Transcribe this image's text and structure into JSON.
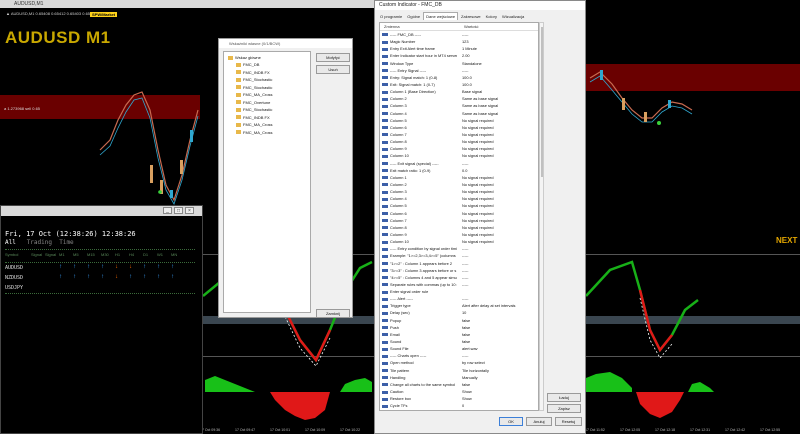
{
  "chart": {
    "window_title": "AUDUSD,M1",
    "info_line": "▲ AUDUSD,M1  0.65408 0.65412 0.65403 0.65411",
    "badge": "SPW/Market",
    "symbol_title": "AUDUSD M1",
    "price_label": "a 1.273968 sell 0.65",
    "next_label": "NEXT",
    "time_ticks": [
      "17 Oct 09:36",
      "17 Oct 09:47",
      "17 Oct 10:01",
      "17 Oct 10:09",
      "17 Oct 10:22",
      "17 Oct 10:35",
      "17 Oct 10:47",
      "17 Oct 11:00",
      "17 Oct 11:13",
      "17 Oct 11:26",
      "17 Oct 11:39",
      "17 Oct 11:52",
      "17 Oct 12:05",
      "17 Oct 12:18",
      "17 Oct 12:31",
      "17 Oct 12:42",
      "17 Oct 12:55"
    ]
  },
  "scanner": {
    "date_line": "Fri, 17 Oct (12:38:26) 12:38:26",
    "tabs": [
      "All",
      "Trading",
      "Time"
    ],
    "header": [
      "Symbol",
      "Signal",
      "Signal",
      "M1",
      "M5",
      "M15",
      "M30",
      "H1",
      "H4",
      "D1",
      "W1",
      "MN"
    ],
    "rows": [
      {
        "symbol": "AUDUSD",
        "arrows": [
          "up",
          "up",
          "up",
          "up",
          "dn",
          "dn",
          "up",
          "up",
          "up"
        ]
      },
      {
        "symbol": "NZDUSD",
        "arrows": [
          "up",
          "up",
          "up",
          "up",
          "dn",
          "up",
          "up",
          "up",
          "up"
        ]
      },
      {
        "symbol": "USDJPY",
        "arrows": [
          "",
          "",
          "",
          "",
          "",
          "",
          "",
          "",
          ""
        ]
      }
    ],
    "win_buttons": [
      "_",
      "□",
      "×"
    ]
  },
  "navigator": {
    "title": "Wskaźniki własne (0/1/BCW)",
    "root": "Wskaz główne",
    "items": [
      "FMC_DB",
      "FMC_INDB FX",
      "FMC_Stochastic",
      "FMC_Stochastic",
      "FMC_MA_Cross",
      "FMC_Overtune",
      "FMC_Stochastic",
      "FMC_INDB FX",
      "FMC_MA_Cross",
      "FMC_MA_Cross"
    ],
    "buttons": {
      "modify": "Mofyfyć",
      "delete": "Usuń",
      "close": "Zamknij"
    }
  },
  "dialog": {
    "title": "Custom Indicator - FMC_DB",
    "tabs": [
      "O programie",
      "Ogólne",
      "Dane wejściowe",
      "Zakresowe",
      "Kolory",
      "Wizualizacja"
    ],
    "active_tab": 2,
    "col_name": "Zmienna",
    "col_value": "Wartość",
    "params": [
      {
        "n": "----- FMC_DB -----",
        "v": "-----"
      },
      {
        "n": "Magic Number",
        "v": "123"
      },
      {
        "n": "Entry Exit Alert time frame",
        "v": "1 Minute"
      },
      {
        "n": "Enter Indicator start hour in MT4 server time",
        "v": "2.00"
      },
      {
        "n": "Window Type",
        "v": "Standalone"
      },
      {
        "n": "----- Entry Signal -----",
        "v": "-----"
      },
      {
        "n": "Entry: Signal match: 1 (0-8)",
        "v": "100.0"
      },
      {
        "n": "Exit: Signal match: 1 (0-7)",
        "v": "100.0"
      },
      {
        "n": "Column 1 (Base Direction)",
        "v": "Base signal"
      },
      {
        "n": "Column 2",
        "v": "Same as base signal"
      },
      {
        "n": "Column 3",
        "v": "Same as base signal"
      },
      {
        "n": "Column 4",
        "v": "Same as base signal"
      },
      {
        "n": "Column 5",
        "v": "No signal required"
      },
      {
        "n": "Column 6",
        "v": "No signal required"
      },
      {
        "n": "Column 7",
        "v": "No signal required"
      },
      {
        "n": "Column 8",
        "v": "No signal required"
      },
      {
        "n": "Column 9",
        "v": "No signal required"
      },
      {
        "n": "Column 10",
        "v": "No signal required"
      },
      {
        "n": "----- Exit signal (special) -----",
        "v": "-----"
      },
      {
        "n": "Exit match ratio: 1 (0-9)",
        "v": "0.0"
      },
      {
        "n": "Column 1",
        "v": "No signal required"
      },
      {
        "n": "Column 2",
        "v": "No signal required"
      },
      {
        "n": "Column 3",
        "v": "No signal required"
      },
      {
        "n": "Column 4",
        "v": "No signal required"
      },
      {
        "n": "Column 5",
        "v": "No signal required"
      },
      {
        "n": "Column 6",
        "v": "No signal required"
      },
      {
        "n": "Column 7",
        "v": "No signal required"
      },
      {
        "n": "Column 8",
        "v": "No signal required"
      },
      {
        "n": "Column 9",
        "v": "No signal required"
      },
      {
        "n": "Column 10",
        "v": "No signal required"
      },
      {
        "n": "----- Entry condition by signal order timin",
        "v": "-----"
      },
      {
        "n": "Example: \"1>=2,3>=3,4>=5\" (columns",
        "v": "-----"
      },
      {
        "n": "\"1>=2\" : Column 1 appears before 2",
        "v": "-----"
      },
      {
        "n": "\"3>=3\" : Column 3 appears before or s",
        "v": "-----"
      },
      {
        "n": "\"4>=5\" : Columns 4 and 5 appear simul",
        "v": "-----"
      },
      {
        "n": "Separate rules with commas (up to 10 ru",
        "v": "-----"
      },
      {
        "n": "Enter signal order rule",
        "v": ""
      },
      {
        "n": "----- Alert -----",
        "v": "-----"
      },
      {
        "n": "Trigger type",
        "v": "Alert after delay at set intervals"
      },
      {
        "n": "Delay (sec)",
        "v": "10"
      },
      {
        "n": "Popup",
        "v": "false"
      },
      {
        "n": "Push",
        "v": "false"
      },
      {
        "n": "Email",
        "v": "false"
      },
      {
        "n": "Sound",
        "v": "false"
      },
      {
        "n": "Sound File",
        "v": "alert.wav"
      },
      {
        "n": "----- Charts open -----",
        "v": "-----"
      },
      {
        "n": "Open method",
        "v": "by row select"
      },
      {
        "n": "Tile pattern",
        "v": "Tile horizontally"
      },
      {
        "n": "Handling",
        "v": "Manually"
      },
      {
        "n": "Change all charts to the same symbol",
        "v": "false"
      },
      {
        "n": "Caution",
        "v": "Show"
      },
      {
        "n": "Restore box",
        "v": "Show"
      },
      {
        "n": "Cycle TFs",
        "v": "0"
      },
      {
        "n": "TF table",
        "v": "1,5,15,60,240,1440,10080,43200"
      },
      {
        "n": "Chart TF",
        "v": "1 Hour"
      }
    ],
    "buttons": {
      "load": "Ładuj",
      "save": "Zapisz",
      "ok": "OK",
      "cancel": "Anuluj",
      "reset": "Resetuj"
    }
  },
  "colors": {
    "gold": "#c9a800",
    "up": "#3aa3ff",
    "down": "#ff6a00",
    "histo_up": "#18c018",
    "histo_dn": "#e01818"
  }
}
